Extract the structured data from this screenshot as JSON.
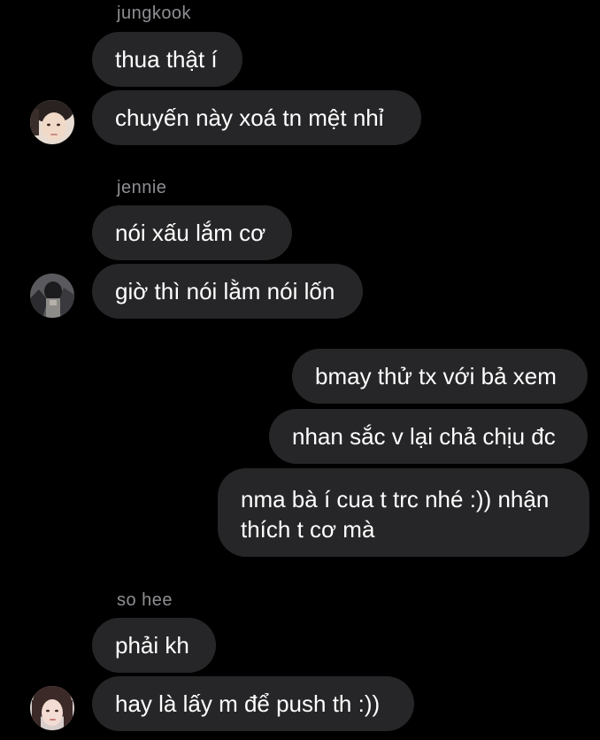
{
  "groups": [
    {
      "sender": "jungkook",
      "messages": [
        "thua thật í",
        "chuyến này xoá tn mệt nhỉ"
      ],
      "avatar_icon": "avatar-photo-icon"
    },
    {
      "sender": "jennie",
      "messages": [
        "nói xấu lắm cơ",
        "giờ thì nói lằm nói lốn"
      ],
      "avatar_icon": "avatar-photo-icon"
    },
    {
      "sender": "so hee",
      "messages": [
        "phải kh",
        "hay là lấy m để push th :))"
      ],
      "avatar_icon": "avatar-photo-icon"
    }
  ],
  "outgoing": {
    "messages": [
      "bmay thử tx với bả xem",
      "nhan sắc v lại chả chịu đc",
      "nma bà í cua t trc nhé :)) nhận thích t cơ mà"
    ]
  },
  "colors": {
    "background": "#000000",
    "bubble": "#262628",
    "sender_name": "#8e8e93",
    "text": "#ffffff"
  }
}
